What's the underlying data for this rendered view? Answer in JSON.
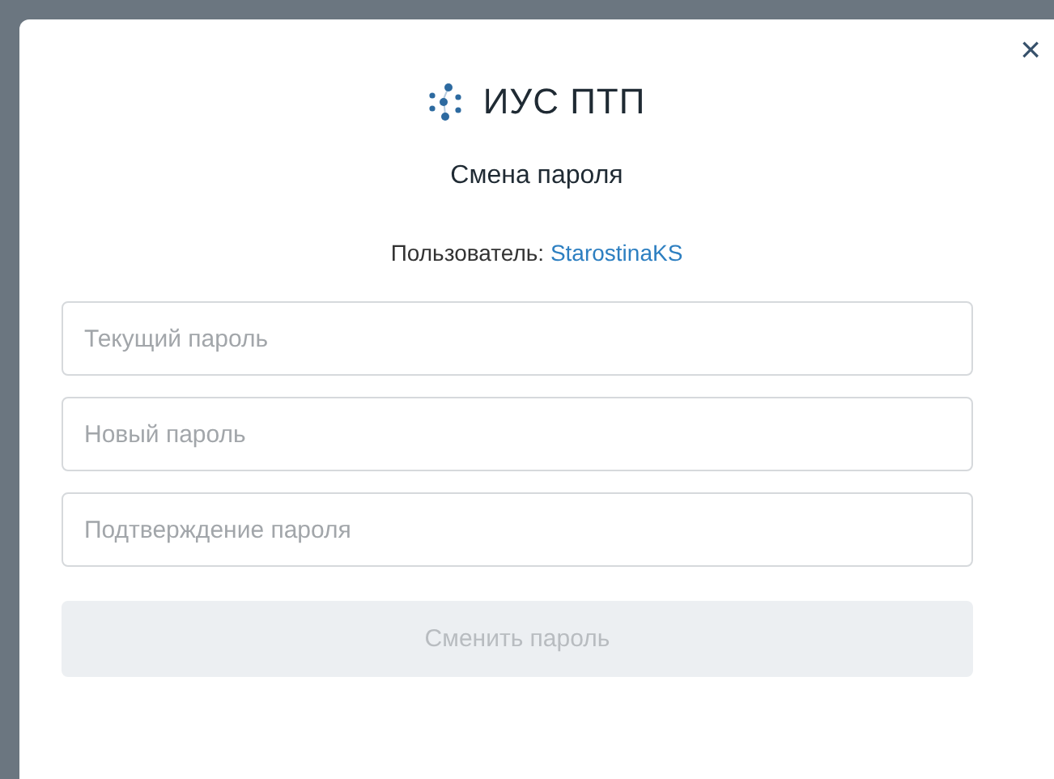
{
  "dialog": {
    "close": "×",
    "logo_text": "ИУС ПТП",
    "title": "Смена пароля",
    "user_label": "Пользователь:",
    "user_name": "StarostinaKS",
    "fields": [
      {
        "placeholder": "Текущий пароль"
      },
      {
        "placeholder": "Новый пароль"
      },
      {
        "placeholder": "Подтверждение пароля"
      }
    ],
    "submit": {
      "label": "Сменить пароль",
      "disabled": true
    }
  }
}
